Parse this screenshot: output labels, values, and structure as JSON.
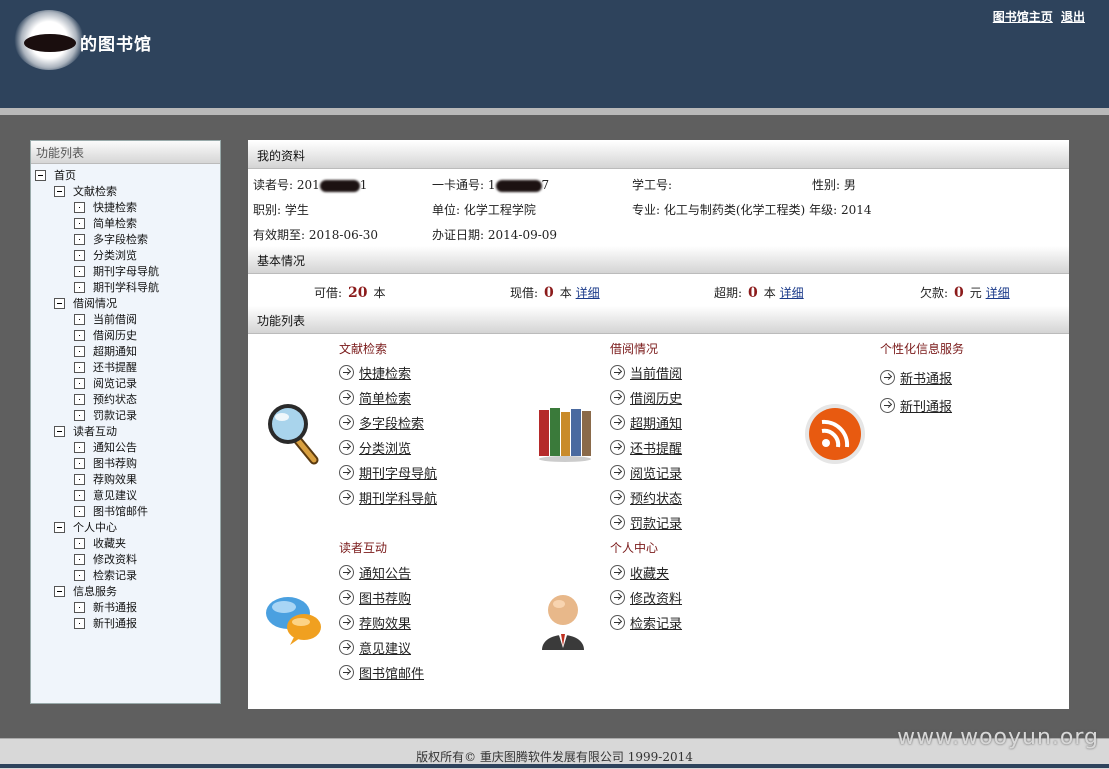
{
  "header": {
    "site_title": "的图书馆",
    "links": [
      "图书馆主页",
      "退出"
    ]
  },
  "sidebar": {
    "title": "功能列表",
    "root": "首页",
    "groups": [
      {
        "label": "文献检索",
        "items": [
          "快捷检索",
          "简单检索",
          "多字段检索",
          "分类浏览",
          "期刊字母导航",
          "期刊学科导航"
        ]
      },
      {
        "label": "借阅情况",
        "items": [
          "当前借阅",
          "借阅历史",
          "超期通知",
          "还书提醒",
          "阅览记录",
          "预约状态",
          "罚款记录"
        ]
      },
      {
        "label": "读者互动",
        "items": [
          "通知公告",
          "图书荐购",
          "荐购效果",
          "意见建议",
          "图书馆邮件"
        ]
      },
      {
        "label": "个人中心",
        "items": [
          "收藏夹",
          "修改资料",
          "检索记录"
        ]
      },
      {
        "label": "信息服务",
        "items": [
          "新书通报",
          "新刊通报"
        ]
      }
    ]
  },
  "profile": {
    "title": "我的资料",
    "reader_no_label": "读者号:",
    "reader_no_prefix": "201",
    "reader_no_suffix": "1",
    "card_no_label": "一卡通号:",
    "card_no_prefix": "1",
    "card_no_suffix": "7",
    "student_no_label": "学工号:",
    "student_no": "",
    "gender_label": "性别:",
    "gender": "男",
    "title_label": "职别:",
    "title_value": "学生",
    "unit_label": "单位:",
    "unit": "化学工程学院",
    "major_label": "专业:",
    "major": "化工与制药类(化学工程类)",
    "grade_label": "年级:",
    "grade": "2014",
    "valid_label": "有效期至:",
    "valid": "2018-06-30",
    "issued_label": "办证日期:",
    "issued": "2014-09-09"
  },
  "basic": {
    "title": "基本情况",
    "can_borrow_label": "可借:",
    "can_borrow": "20",
    "can_borrow_unit": "本",
    "current_label": "现借:",
    "current": "0",
    "current_unit": "本",
    "overdue_label": "超期:",
    "overdue": "0",
    "overdue_unit": "本",
    "debt_label": "欠款:",
    "debt": "0",
    "debt_unit": "元",
    "detail": "详细"
  },
  "functions": {
    "title": "功能列表",
    "groups": [
      {
        "title": "文献检索",
        "items": [
          "快捷检索",
          "简单检索",
          "多字段检索",
          "分类浏览",
          "期刊字母导航",
          "期刊学科导航"
        ]
      },
      {
        "title": "借阅情况",
        "items": [
          "当前借阅",
          "借阅历史",
          "超期通知",
          "还书提醒",
          "阅览记录",
          "预约状态",
          "罚款记录"
        ]
      },
      {
        "title": "个性化信息服务",
        "items": [
          "新书通报",
          "新刊通报"
        ]
      },
      {
        "title": "读者互动",
        "items": [
          "通知公告",
          "图书荐购",
          "荐购效果",
          "意见建议",
          "图书馆邮件"
        ]
      },
      {
        "title": "个人中心",
        "items": [
          "收藏夹",
          "修改资料",
          "检索记录"
        ]
      }
    ]
  },
  "footer": {
    "copyright": "版权所有© 重庆图腾软件发展有限公司 1999-2014",
    "watermark": "www.wooyun.org"
  },
  "colors": {
    "header_bg": "#2e435c",
    "page_bg": "#5f5f5f",
    "accent_number": "#8b1a1a"
  }
}
